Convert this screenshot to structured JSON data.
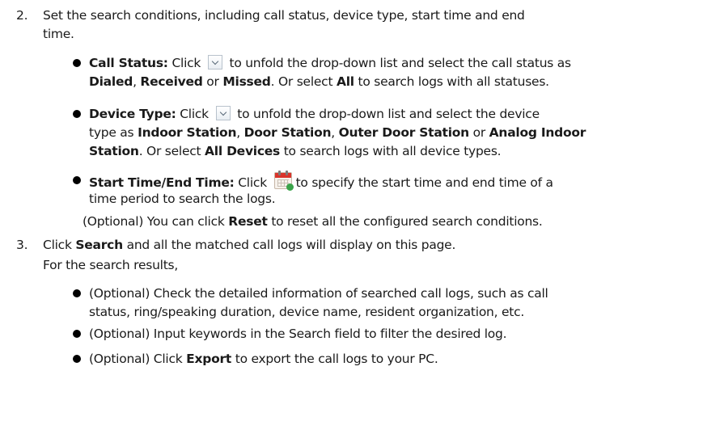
{
  "step2": {
    "number": "2.",
    "line1": "Set the search conditions, including call status, device type, start time and end",
    "line2": "time."
  },
  "call_status": {
    "label": "Call Status:",
    "t1": " Click ",
    "t2": " to unfold the drop-down list and select the call status as",
    "opt1": "Dialed",
    "sep1": ", ",
    "opt2": "Received",
    "sep2": " or ",
    "opt3": "Missed",
    "t3": ". Or select ",
    "opt_all": "All",
    "t4": " to search logs with all statuses."
  },
  "device_type": {
    "label": "Device Type:",
    "t1": " Click ",
    "t2": " to unfold the drop-down list and select the device",
    "t3": "type as ",
    "opt1": "Indoor Station",
    "sep1": ", ",
    "opt2": "Door Station",
    "sep2": ", ",
    "opt3": "Outer Door Station",
    "sep3": " or ",
    "opt4": "Analog Indoor",
    "opt4b": "Station",
    "t4": ". Or select ",
    "opt_all": "All Devices",
    "t5": " to search logs with all device types."
  },
  "time": {
    "label": "Start Time/End Time:",
    "t1": " Click ",
    "t2": "to specify the start time and end time of a",
    "t3": "time period to search the logs."
  },
  "optional_reset": {
    "t1": "(Optional) You can click ",
    "btn": "Reset",
    "t2": " to reset all the configured search conditions."
  },
  "step3": {
    "number": "3.",
    "t1": "Click ",
    "btn": "Search",
    "t2": " and all the matched call logs will display on this page.",
    "results_intro": "For the search results,"
  },
  "results": {
    "item1_line1": "(Optional) Check the detailed information of searched call logs, such as call",
    "item1_line2": "status, ring/speaking duration, device name, resident organization, etc.",
    "item2": "(Optional) Input keywords in the Search field to filter the desired log.",
    "item3_t1": "(Optional) Click ",
    "item3_btn": "Export",
    "item3_t2": " to export the call logs to your PC."
  },
  "icons": {
    "dropdown": "dropdown-arrow-icon",
    "calendar": "calendar-icon",
    "bullet": "bullet-icon"
  }
}
